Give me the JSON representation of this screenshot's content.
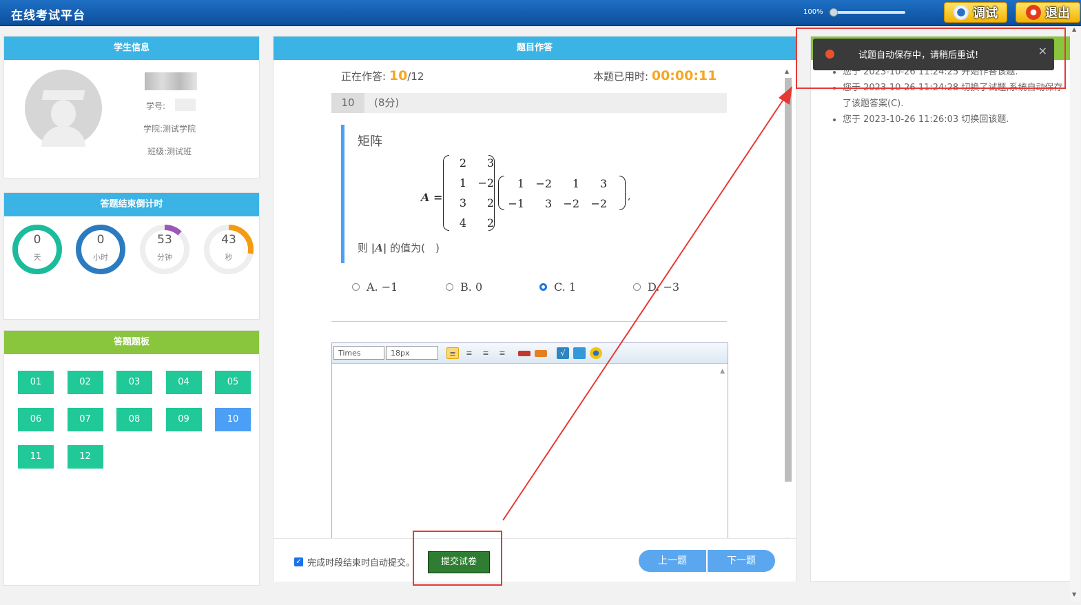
{
  "app": {
    "title": "在线考试平台",
    "zoom": "100%",
    "debug_label": "调试",
    "exit_label": "退出"
  },
  "student": {
    "header": "学生信息",
    "id_label": "学号:",
    "college": "学院:测试学院",
    "class": "班级:测试班"
  },
  "countdown": {
    "header": "答题结束倒计时",
    "items": [
      {
        "value": "0",
        "unit": "天",
        "color": "#1abc9c",
        "fraction": 1.0
      },
      {
        "value": "0",
        "unit": "小时",
        "color": "#2b7bc1",
        "fraction": 1.0
      },
      {
        "value": "53",
        "unit": "分钟",
        "color": "#9b59b6",
        "fraction": 0.12
      },
      {
        "value": "43",
        "unit": "秒",
        "color": "#f39c12",
        "fraction": 0.28
      }
    ]
  },
  "board": {
    "header": "答题题板",
    "questions": [
      "01",
      "02",
      "03",
      "04",
      "05",
      "06",
      "07",
      "08",
      "09",
      "10",
      "11",
      "12"
    ],
    "current": "10"
  },
  "question": {
    "header": "题目作答",
    "answering_label": "正在作答:",
    "current": "10",
    "total": "/12",
    "time_label": "本题已用时:",
    "time_used": "00:00:11",
    "number": "10",
    "score": "(8分)",
    "title": "矩阵",
    "matrix_name": "A",
    "left_matrix": [
      [
        "2",
        "3"
      ],
      [
        "1",
        "−2"
      ],
      [
        "3",
        "2"
      ],
      [
        "4",
        "2"
      ]
    ],
    "right_matrix": [
      [
        "1",
        "−2",
        "1",
        "3"
      ],
      [
        "−1",
        "3",
        "−2",
        "−2"
      ]
    ],
    "ask_prefix": "则",
    "ask_suffix": "的值为(　)",
    "options": [
      {
        "label": "A.",
        "value": "−1",
        "selected": false
      },
      {
        "label": "B.",
        "value": "0",
        "selected": false
      },
      {
        "label": "C.",
        "value": "1",
        "selected": true
      },
      {
        "label": "D.",
        "value": "−3",
        "selected": false
      }
    ]
  },
  "editor": {
    "font": "Times",
    "size": "18px"
  },
  "footer": {
    "auto_submit": "完成时段结束时自动提交。",
    "submit": "提交试卷",
    "prev": "上一题",
    "next": "下一题"
  },
  "log": {
    "entries": [
      "您于 2023-10-26  11:24:25 开始作答该题.",
      "您于 2023-10-26  11:24:28 切换了试题,系统自动保存了该题答案(C).",
      "您于 2023-10-26  11:26:03 切换回该题."
    ]
  },
  "toast": {
    "message": "试题自动保存中，请稍后重试!",
    "close": "×"
  }
}
